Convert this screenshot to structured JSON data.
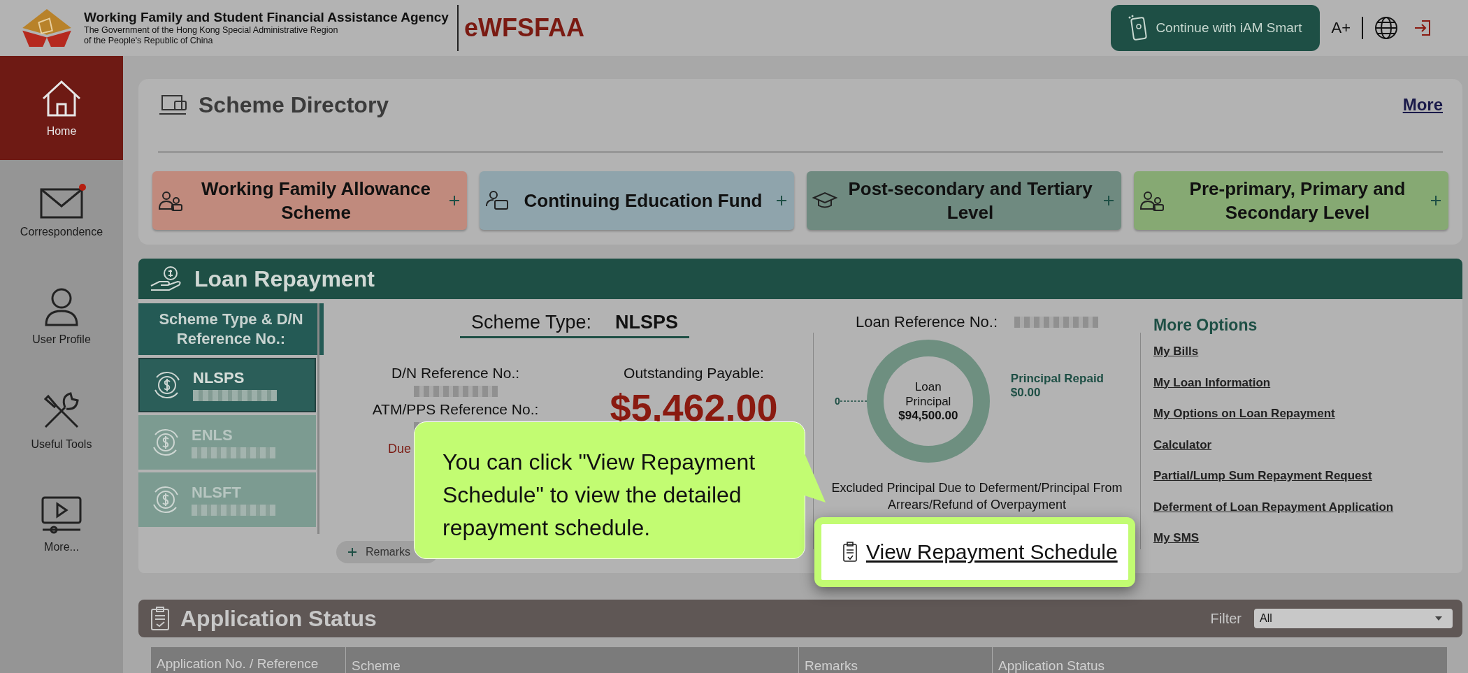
{
  "header": {
    "agency_name": "Working Family and Student Financial Assistance Agency",
    "government_line_1": "The Government of the Hong Kong Special Administrative Region",
    "government_line_2": "of the People's Republic of China",
    "system_name": "eWFSFAA",
    "iam_smart_button": "Continue with iAM Smart",
    "font_size_button": "A+"
  },
  "sidebar": {
    "items": [
      {
        "label": "Home",
        "kind": "home",
        "selected": true,
        "notification": false
      },
      {
        "label": "Correspondence",
        "kind": "mail",
        "selected": false,
        "notification": true
      },
      {
        "label": "User Profile",
        "kind": "user",
        "selected": false,
        "notification": false
      },
      {
        "label": "Useful Tools",
        "kind": "tools",
        "selected": false,
        "notification": false
      },
      {
        "label": "More...",
        "kind": "more",
        "selected": false,
        "notification": false
      }
    ]
  },
  "scheme_directory": {
    "title": "Scheme Directory",
    "more_link": "More",
    "schemes": [
      {
        "label": "Working Family Allowance Scheme",
        "color": "#c08a7d",
        "kind": "family"
      },
      {
        "label": "Continuing Education Fund",
        "color": "#8fa4ac",
        "kind": "education"
      },
      {
        "label": "Post-secondary and Tertiary Level",
        "color": "#6f8a80",
        "kind": "tertiary"
      },
      {
        "label": "Pre-primary, Primary and Secondary Level",
        "color": "#86a973",
        "kind": "school"
      }
    ]
  },
  "loan_repayment": {
    "title": "Loan Repayment",
    "list_header": "Scheme Type & D/N Reference No.:",
    "schemes": [
      {
        "name": "NLSPS",
        "selected": true
      },
      {
        "name": "ENLS",
        "selected": false
      },
      {
        "name": "NLSFT",
        "selected": false
      }
    ],
    "scheme_type_label": "Scheme Type:",
    "scheme_type_value": "NLSPS",
    "dn_label": "D/N Reference No.:",
    "atm_label": "ATM/PPS Reference No.:",
    "due_text": "Due",
    "outstanding_label": "Outstanding Payable:",
    "outstanding_amount": "$5,462.00",
    "remarks_button": "Remarks",
    "loan_reference_label": "Loan Reference No.:",
    "zero_label": "0",
    "donut_label": "Loan Principal",
    "donut_amount": "$94,500.00",
    "principal_repaid_label": "Principal Repaid",
    "principal_repaid_value": "$0.00",
    "excluded_text": "Excluded Principal Due to Deferment/Principal From Arrears/Refund of Overpayment",
    "more_options_title": "More Options",
    "more_options": [
      "My Bills",
      "My Loan Information",
      "My Options on Loan Repayment",
      "Calculator",
      "Partial/Lump Sum Repayment Request",
      "Deferment of Loan Repayment Application",
      "My SMS"
    ],
    "view_schedule_link": "View Repayment Schedule"
  },
  "callout": {
    "text": "You can click \"View Repayment Schedule\" to view the detailed repayment schedule."
  },
  "application_status": {
    "title": "Application Status",
    "filter_label": "Filter",
    "filter_value": "All",
    "columns": [
      "Application No. / Reference",
      "Scheme",
      "Remarks",
      "Application Status"
    ]
  }
}
